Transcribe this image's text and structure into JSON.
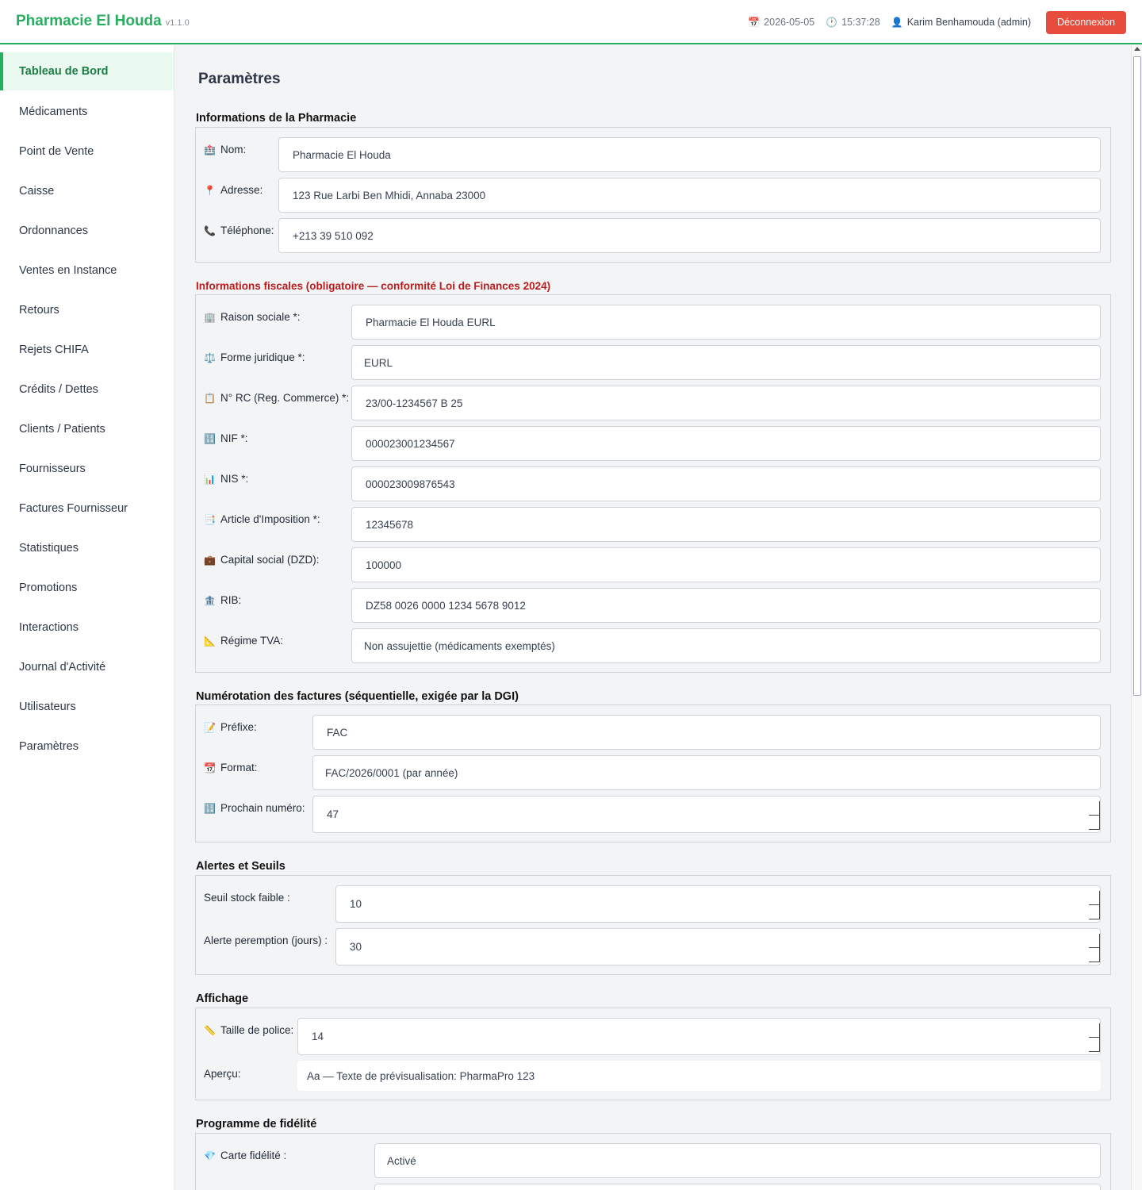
{
  "app": {
    "name": "Pharmacie El Houda",
    "version": "v1.1.0"
  },
  "header": {
    "date": "2026-05-05",
    "time": "15:37:28",
    "user": "Karim Benhamouda (admin)",
    "logout_label": "Déconnexion",
    "date_icon": "📅",
    "clock_icon": "🕐",
    "user_icon": "👤"
  },
  "sidebar": {
    "items": [
      {
        "label": "Tableau de Bord",
        "active": true
      },
      {
        "label": "Médicaments"
      },
      {
        "label": "Point de Vente"
      },
      {
        "label": "Caisse"
      },
      {
        "label": "Ordonnances"
      },
      {
        "label": "Ventes en Instance"
      },
      {
        "label": "Retours"
      },
      {
        "label": "Rejets CHIFA"
      },
      {
        "label": "Crédits / Dettes"
      },
      {
        "label": "Clients / Patients"
      },
      {
        "label": "Fournisseurs"
      },
      {
        "label": "Factures Fournisseur"
      },
      {
        "label": "Statistiques"
      },
      {
        "label": "Promotions"
      },
      {
        "label": "Interactions"
      },
      {
        "label": "Journal d'Activité"
      },
      {
        "label": "Utilisateurs"
      },
      {
        "label": "Paramètres"
      }
    ]
  },
  "page_title": "Paramètres",
  "pharmacy_info": {
    "title": "Informations de la Pharmacie",
    "fields": [
      {
        "icon": "🏥",
        "label": "Nom:",
        "value": "Pharmacie El Houda"
      },
      {
        "icon": "📍",
        "label": "Adresse:",
        "value": "123 Rue Larbi Ben Mhidi, Annaba 23000"
      },
      {
        "icon": "📞",
        "label": "Téléphone:",
        "value": "+213 39 510 092"
      }
    ]
  },
  "fiscal": {
    "title": "Informations fiscales (obligatoire — conformité Loi de Finances 2024)",
    "title_color": "#b91c1c",
    "fields": [
      {
        "icon": "🏢",
        "label": "Raison sociale *:",
        "value": "Pharmacie El Houda EURL"
      },
      {
        "icon": "⚖️",
        "label": "Forme juridique *:",
        "value": "EURL"
      },
      {
        "icon": "📋",
        "label": "N° RC (Reg. Commerce) *:",
        "value": "23/00-1234567 B 25"
      },
      {
        "icon": "🔢",
        "label": "NIF *:",
        "value": "000023001234567"
      },
      {
        "icon": "📊",
        "label": "NIS *:",
        "value": "000023009876543"
      },
      {
        "icon": "📑",
        "label": "Article d'Imposition *:",
        "value": "12345678"
      },
      {
        "icon": "💼",
        "label": "Capital social (DZD):",
        "value": "100000"
      },
      {
        "icon": "🏦",
        "label": "RIB:",
        "value": "DZ58 0026 0000 1234 5678 9012"
      },
      {
        "icon": "📐",
        "label": "Régime TVA:",
        "value": "Non assujettie (médicaments exemptés)"
      }
    ]
  },
  "invoice_numbering": {
    "title": "Numérotation des factures (séquentielle, exigée par la DGI)",
    "fields": [
      {
        "icon": "📝",
        "label": "Préfixe:",
        "value": "FAC"
      },
      {
        "icon": "📆",
        "label": "Format:",
        "value": "FAC/2026/0001 (par année)"
      },
      {
        "icon": "🔢",
        "label": "Prochain numéro:",
        "value": "47"
      }
    ]
  },
  "alerts": {
    "title": "Alertes et Seuils",
    "fields": [
      {
        "label": "Seuil stock faible :",
        "value": "10"
      },
      {
        "label": "Alerte peremption (jours) :",
        "value": "30"
      }
    ]
  },
  "display": {
    "title": "Affichage",
    "font_size": {
      "icon": "📏",
      "label": "Taille de police:",
      "value": "14"
    },
    "preview": {
      "label": "Aperçu:",
      "value": "Aa — Texte de prévisualisation: PharmaPro 123"
    }
  },
  "loyalty": {
    "title": "Programme de fidélité",
    "fields": [
      {
        "icon": "💎",
        "label": "Carte fidélité :",
        "value": "Activé"
      }
    ]
  },
  "colors": {
    "brand": "#27ae60",
    "danger": "#e74c3c",
    "fiscal_title": "#b91c1c"
  }
}
